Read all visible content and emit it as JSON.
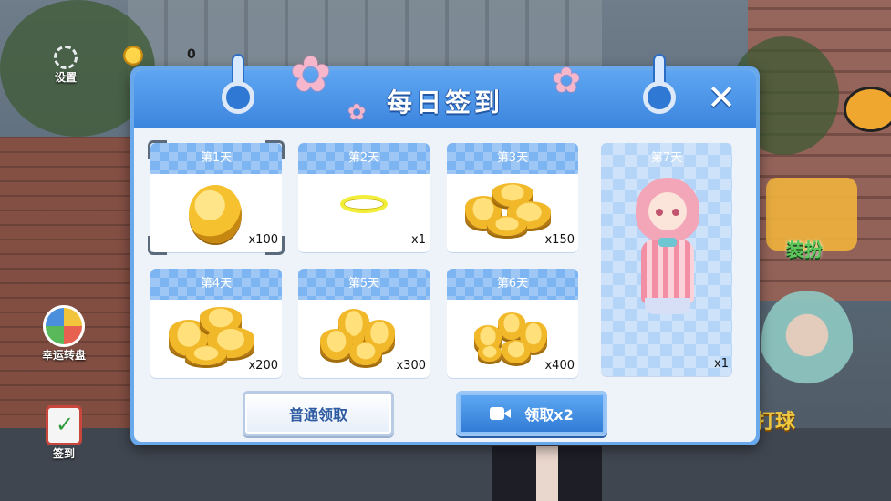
{
  "hud": {
    "settings_label": "设置",
    "coin_value": "0",
    "wheel_label": "幸运转盘",
    "checkin_label": "签到",
    "equip_label": "装扮",
    "side_label": "打球"
  },
  "modal": {
    "title": "每日签到",
    "close_symbol": "✕"
  },
  "rewards": [
    {
      "day": "第1天",
      "item": "gold-coin",
      "qty": "x100"
    },
    {
      "day": "第2天",
      "item": "gold-ring",
      "qty": "x1"
    },
    {
      "day": "第3天",
      "item": "coin-pile",
      "qty": "x150"
    },
    {
      "day": "第4天",
      "item": "coin-pile",
      "qty": "x200"
    },
    {
      "day": "第5天",
      "item": "coin-pile",
      "qty": "x300"
    },
    {
      "day": "第6天",
      "item": "coin-pile",
      "qty": "x400"
    },
    {
      "day": "第7天",
      "item": "character-outfit",
      "qty": "x1"
    }
  ],
  "buttons": {
    "normal_claim": "普通领取",
    "double_claim": "领取x2"
  },
  "colors": {
    "header_blue": "#3c85de",
    "tile_pattern_blue": "#7db4f2",
    "coin_gold": "#f6c12f",
    "sakura_pink": "#f6b7cd"
  }
}
